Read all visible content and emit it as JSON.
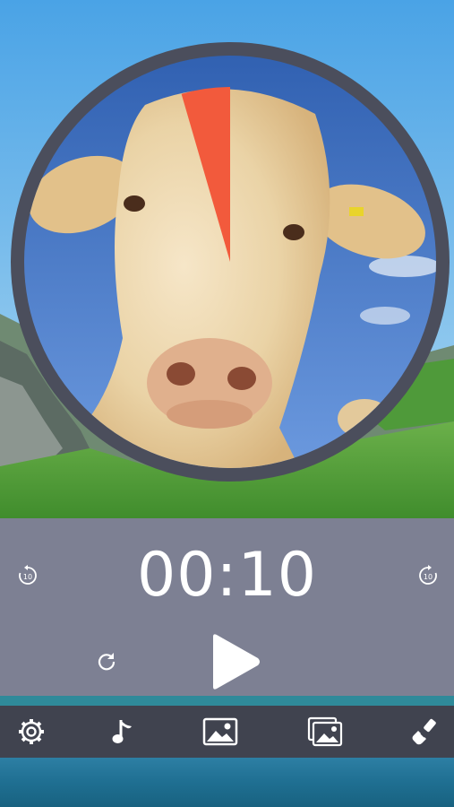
{
  "timer": {
    "display": "00:10",
    "remaining_fraction": 0.045
  },
  "controls": {
    "rewind_icon": "replay-10-icon",
    "forward_icon": "forward-10-icon",
    "reset_icon": "reset-icon",
    "play_icon": "play-icon"
  },
  "toolbar": {
    "items": [
      "gear-icon",
      "music-note-icon",
      "image-icon",
      "gallery-icon",
      "brush-icon"
    ]
  },
  "colors": {
    "dial_ring": "#4b4e5c",
    "wedge": "#f25a3c",
    "panel": "#7d8093",
    "toolbar": "#40434f"
  }
}
